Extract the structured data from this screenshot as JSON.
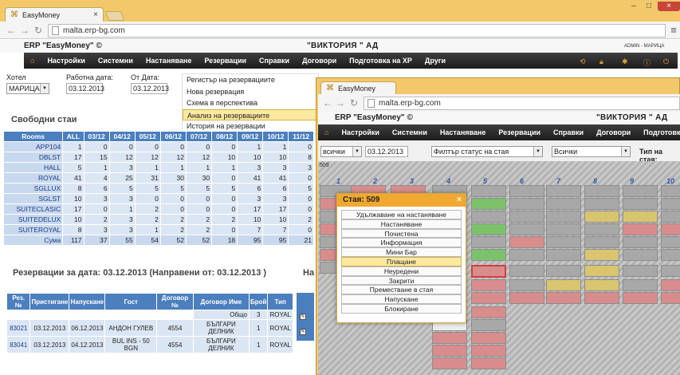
{
  "browser": {
    "tab_title": "EasyMoney",
    "url": "malta.erp-bg.com"
  },
  "app": {
    "erp_title": "ERP \"EasyMoney\" ©",
    "company": "\"ВИКТОРИЯ \" АД",
    "user": "ADMIN - МАРИЦА",
    "nav": [
      "Настройки",
      "Системни",
      "Настаняване",
      "Резервации",
      "Справки",
      "Договори",
      "Подготовка на ХР",
      "Други"
    ]
  },
  "form": {
    "hotel_label": "Хотел",
    "hotel_value": "МАРИЦА",
    "workdate_label": "Работна дата:",
    "workdate_value": "03.12.2013",
    "fromdate_label": "От Дата:",
    "fromdate_value": "03.12.2013"
  },
  "dropdown": [
    "Регистър на резервациите",
    "Нова резервация",
    "Схема в перспектива",
    "Анализ на резервациите",
    "История на резервации"
  ],
  "free_rooms": {
    "title": "Свободни стаи",
    "headers": [
      "Rooms",
      "ALL",
      "03/12",
      "04/12",
      "05/12",
      "06/12",
      "07/12",
      "08/12",
      "09/12",
      "10/12",
      "11/12"
    ],
    "rows": [
      [
        "APP104",
        "1",
        "0",
        "0",
        "0",
        "0",
        "0",
        "0",
        "1",
        "1",
        "0"
      ],
      [
        "DBLST",
        "17",
        "15",
        "12",
        "12",
        "12",
        "12",
        "10",
        "10",
        "10",
        "8"
      ],
      [
        "HALL",
        "5",
        "1",
        "3",
        "1",
        "1",
        "1",
        "1",
        "3",
        "3",
        "3"
      ],
      [
        "ROYAL",
        "41",
        "4",
        "25",
        "31",
        "30",
        "30",
        "0",
        "41",
        "41",
        "0"
      ],
      [
        "SGLLUX",
        "8",
        "6",
        "5",
        "5",
        "5",
        "5",
        "5",
        "6",
        "6",
        "5"
      ],
      [
        "SGLST",
        "10",
        "3",
        "3",
        "0",
        "0",
        "0",
        "0",
        "3",
        "3",
        "0"
      ],
      [
        "SUITECLASIC",
        "17",
        "0",
        "1",
        "2",
        "0",
        "0",
        "0",
        "17",
        "17",
        "0"
      ],
      [
        "SUITEDELUX",
        "10",
        "2",
        "3",
        "2",
        "2",
        "2",
        "2",
        "10",
        "10",
        "2"
      ],
      [
        "SUITEROYAL",
        "8",
        "3",
        "3",
        "1",
        "2",
        "2",
        "0",
        "7",
        "7",
        "0"
      ],
      [
        "Сума",
        "117",
        "37",
        "55",
        "54",
        "52",
        "52",
        "18",
        "95",
        "95",
        "21"
      ]
    ]
  },
  "reservations": {
    "title": "Резервации за дата: 03.12.2013 (Направени от: 03.12.2013 )",
    "title_right": "На",
    "headers": [
      "Рез. №",
      "Пристигане",
      "Напускане",
      "Гост",
      "Договор №",
      "Договор Име",
      "Брой",
      "Тип"
    ],
    "total_label": "Общо",
    "total_count": "3",
    "total_type": "ROYAL",
    "rows": [
      [
        "83021",
        "03.12.2013",
        "06.12.2013",
        "АНДОН ГУЛЕВ",
        "4554",
        "БЪЛГАРИ ДЕЛНИК",
        "1",
        "ROYAL"
      ],
      [
        "83041",
        "03.12.2013",
        "04.12.2013",
        "BUL INS - 50 BGN",
        "4554",
        "БЪЛГАРИ ДЕЛНИК",
        "1",
        "ROYAL"
      ]
    ]
  },
  "w2": {
    "filter_all": "всички",
    "date": "03.12.2013",
    "status_filter": "Филтър статус на стая",
    "all2": "Всички",
    "room_type": "Тип на стая:",
    "floor_label": "509",
    "columns": [
      "1",
      "2",
      "3",
      "4",
      "5",
      "6",
      "7",
      "8",
      "9",
      "10"
    ]
  },
  "popup": {
    "title": "Стая: 509",
    "items": [
      "Удължаване на настаняване",
      "Настаняване",
      "Почистена",
      "Информация",
      "Мини Бар",
      "Плащане",
      "Неуредени",
      "Закрити",
      "Преместване в стая",
      "Напускане",
      "Блокиране"
    ]
  }
}
